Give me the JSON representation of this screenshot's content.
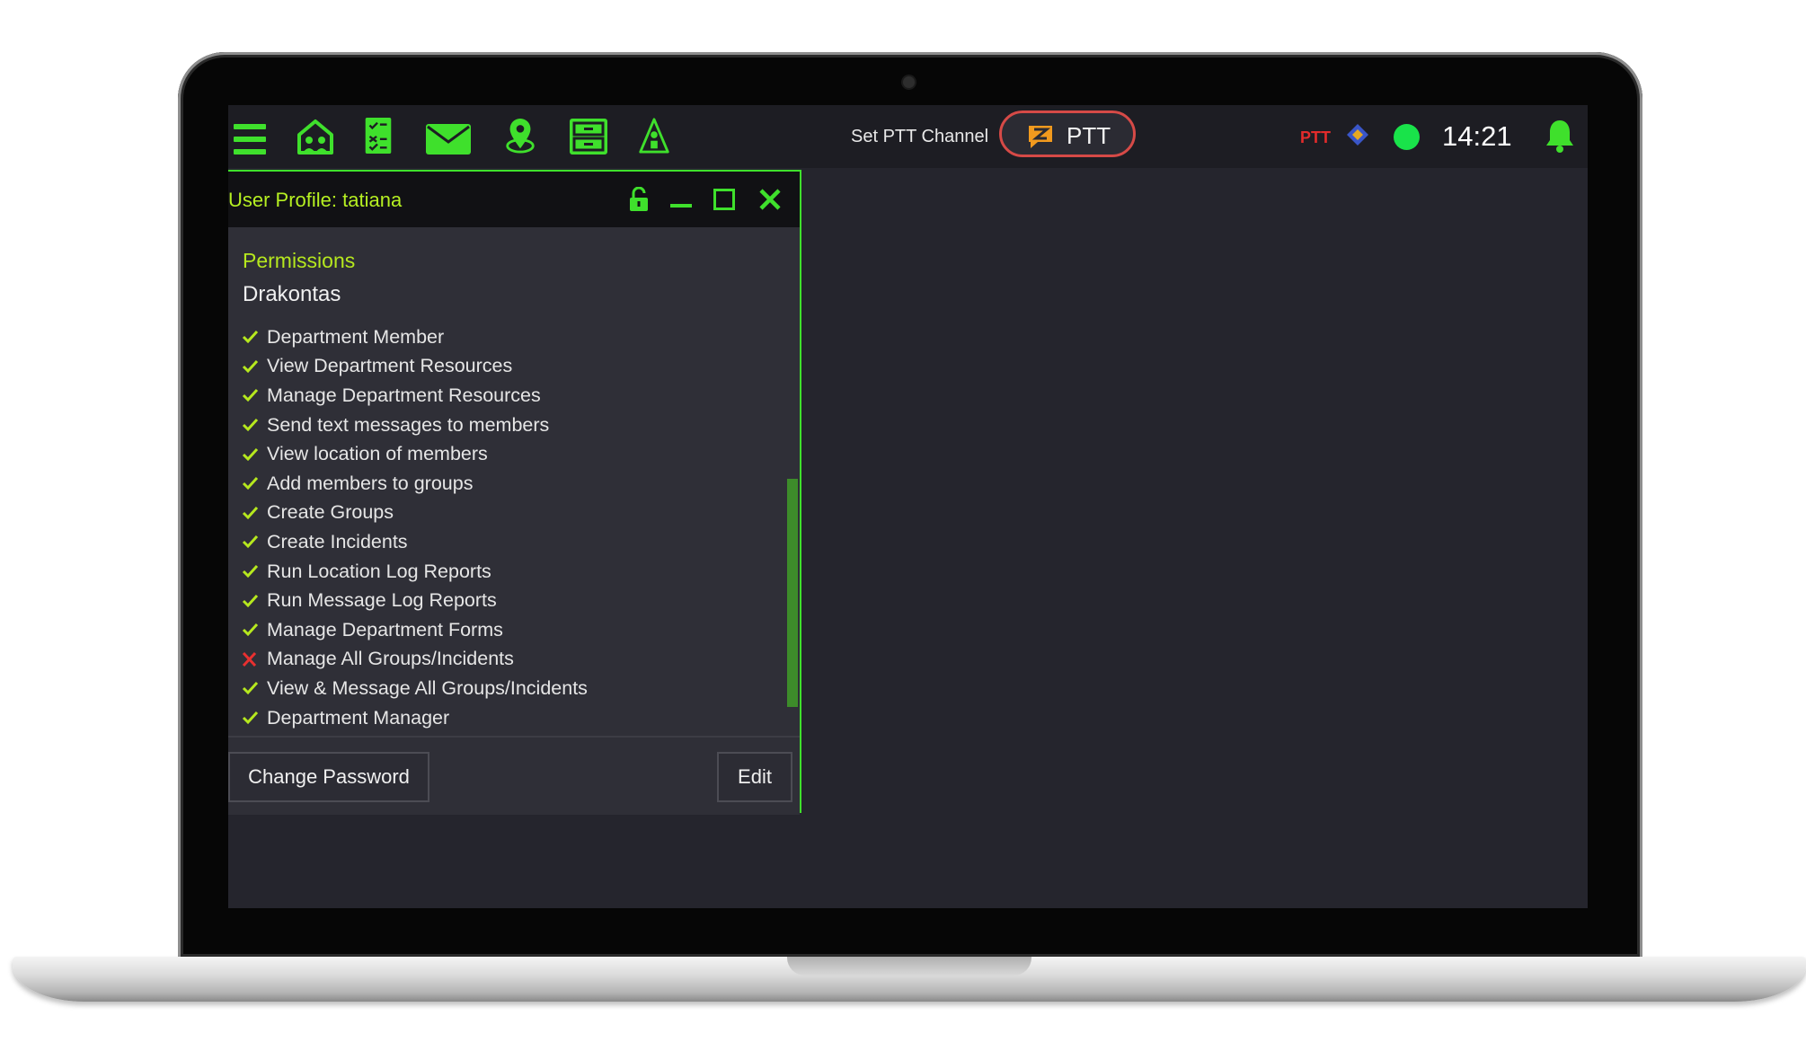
{
  "toolbar": {
    "icons": [
      "menu-icon",
      "home-icon",
      "checklist-icon",
      "mail-icon",
      "map-pin-icon",
      "files-icon",
      "incident-icon"
    ],
    "ptt_channel_label": "Set PTT Channel",
    "ptt_button_label": "PTT",
    "ptt_status_label": "PTT",
    "clock": "14:21",
    "accent": "#3fe02c"
  },
  "panel": {
    "title": "User Profile: tatiana",
    "permissions_heading": "Permissions",
    "department": "Drakontas",
    "permissions": [
      {
        "label": "Department Member",
        "granted": true
      },
      {
        "label": "View Department Resources",
        "granted": true
      },
      {
        "label": "Manage Department Resources",
        "granted": true
      },
      {
        "label": "Send text messages to members",
        "granted": true
      },
      {
        "label": "View location of members",
        "granted": true
      },
      {
        "label": "Add members to groups",
        "granted": true
      },
      {
        "label": "Create Groups",
        "granted": true
      },
      {
        "label": "Create Incidents",
        "granted": true
      },
      {
        "label": "Run Location Log Reports",
        "granted": true
      },
      {
        "label": "Run Message Log Reports",
        "granted": true
      },
      {
        "label": "Manage Department Forms",
        "granted": true
      },
      {
        "label": "Manage All Groups/Incidents",
        "granted": false
      },
      {
        "label": "View & Message All Groups/Incidents",
        "granted": true
      },
      {
        "label": "Department Manager",
        "granted": true
      }
    ],
    "change_password_label": "Change Password",
    "edit_label": "Edit"
  },
  "colors": {
    "granted": "#b6e81e",
    "denied": "#e83030",
    "ptt_border": "#d64a47",
    "status_online": "#19e34a"
  }
}
